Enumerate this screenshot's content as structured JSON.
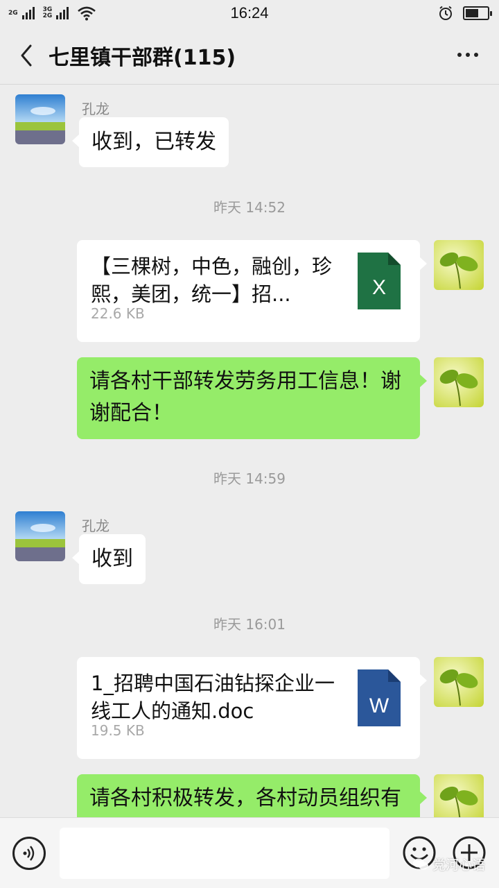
{
  "status_bar": {
    "sim1_label": "2G",
    "sim2_label": "3G\n2G",
    "time": "16:24",
    "alarm_icon": "alarm-clock-icon",
    "battery_icon": "battery-icon",
    "battery_level": 0.6
  },
  "header": {
    "back_icon": "chevron-left-icon",
    "title": "七里镇干部群(115)",
    "more_icon": "more-dots-icon"
  },
  "messages": [
    {
      "type": "text",
      "side": "left",
      "sender": "孔龙",
      "text": "收到，已转发"
    },
    {
      "type": "timestamp",
      "text": "昨天 14:52"
    },
    {
      "type": "file",
      "side": "right",
      "file_name": "【三棵树，中色，融创，珍熙，美团，统一】招...",
      "size": "22.6 KB",
      "icon": "excel-file-icon",
      "icon_letter": "X",
      "icon_color": "#1f7244"
    },
    {
      "type": "text",
      "side": "right",
      "text": "请各村干部转发劳务用工信息！谢谢配合！"
    },
    {
      "type": "timestamp",
      "text": "昨天 14:59"
    },
    {
      "type": "text",
      "side": "left",
      "sender": "孔龙",
      "text": "收到"
    },
    {
      "type": "timestamp",
      "text": "昨天 16:01"
    },
    {
      "type": "file",
      "side": "right",
      "file_name": "1_招聘中国石油钻探企业一线工人的通知.doc",
      "size": "19.5 KB",
      "icon": "word-file-icon",
      "icon_letter": "W",
      "icon_color": "#2b579a"
    },
    {
      "type": "text",
      "side": "right",
      "text": "请各村积极转发，各村动员组织有"
    }
  ],
  "bottom_bar": {
    "voice_icon": "voice-icon",
    "input_value": "",
    "emoji_icon": "emoji-icon",
    "plus_icon": "plus-icon"
  },
  "watermark": "党河心语",
  "colors": {
    "background": "#ededed",
    "green_bubble": "#95ec69",
    "white_bubble": "#ffffff",
    "timestamp": "#9a9a9a"
  }
}
